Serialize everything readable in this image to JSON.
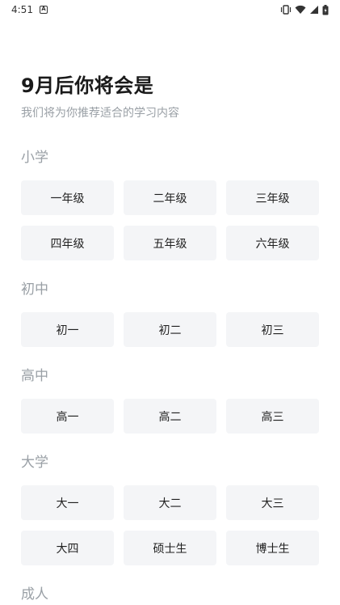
{
  "status_bar": {
    "time": "4:51",
    "notification_icon": "a-box-icon",
    "icons": [
      "vibrate-icon",
      "wifi-icon",
      "signal-icon",
      "battery-icon"
    ]
  },
  "header": {
    "title": "9月后你将会是",
    "subtitle": "我们将为你推荐适合的学习内容"
  },
  "sections": {
    "primary": {
      "label": "小学",
      "options": [
        "一年级",
        "二年级",
        "三年级",
        "四年级",
        "五年级",
        "六年级"
      ]
    },
    "junior": {
      "label": "初中",
      "options": [
        "初一",
        "初二",
        "初三"
      ]
    },
    "senior": {
      "label": "高中",
      "options": [
        "高一",
        "高二",
        "高三"
      ]
    },
    "university": {
      "label": "大学",
      "options": [
        "大一",
        "大二",
        "大三",
        "大四",
        "硕士生",
        "博士生"
      ]
    },
    "adult": {
      "label": "成人"
    }
  },
  "colors": {
    "chip_bg": "#f4f5f7",
    "section_label": "#9aa0a6",
    "title": "#1a1a1a"
  }
}
